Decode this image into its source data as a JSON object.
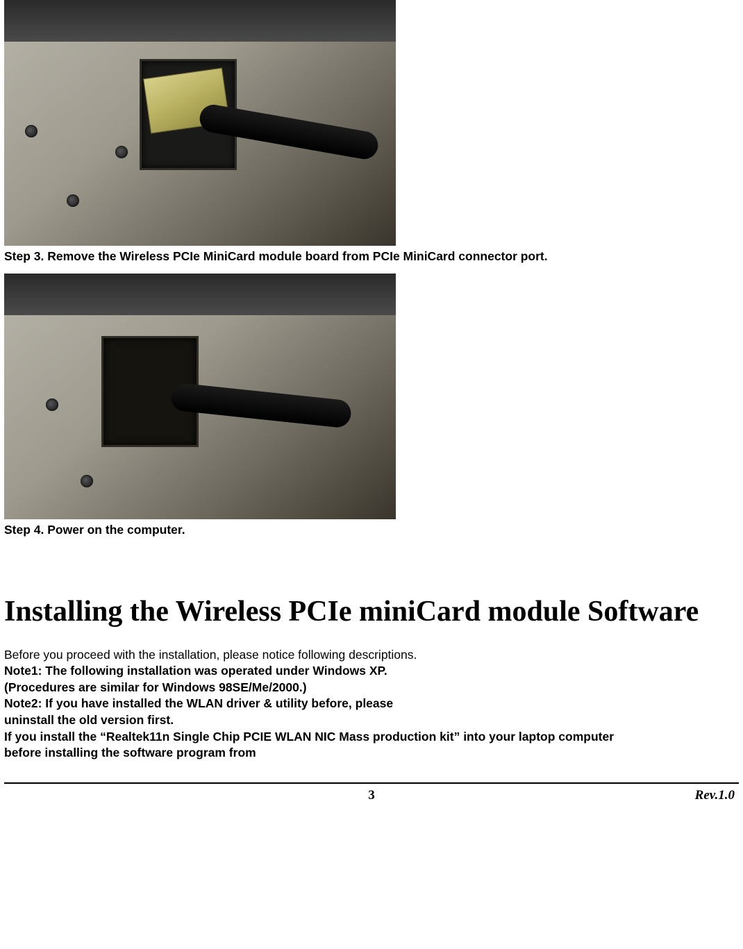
{
  "step3_caption": "Step 3. Remove the Wireless PCIe MiniCard module board from PCIe MiniCard connector port.",
  "step4_caption": "Step 4. Power on the computer.",
  "section_title": "Installing the Wireless PCIe miniCard module Software",
  "body": {
    "intro": "Before you proceed with the installation, please notice following descriptions.",
    "note1_line1": "Note1: The following installation was operated under Windows XP.",
    "note1_line2": "(Procedures are similar for Windows 98SE/Me/2000.)",
    "note2_line1": "Note2: If you have installed the WLAN driver & utility before, please",
    "note2_line2": "uninstall the old version first.",
    "cont_line1": "If you install the “Realtek11n Single Chip PCIE WLAN NIC Mass production kit” into your laptop computer",
    "cont_line2": "before installing the software program from"
  },
  "footer": {
    "page_number": "3",
    "revision": "Rev.1.0"
  }
}
